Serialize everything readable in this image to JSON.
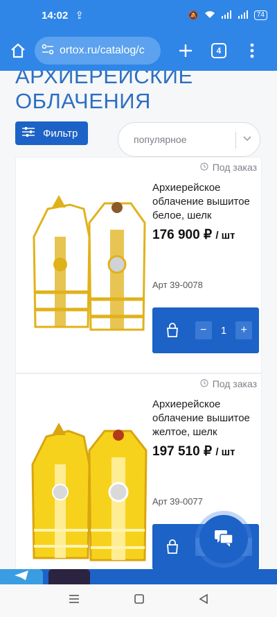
{
  "status_bar": {
    "time": "14:02",
    "battery": "74"
  },
  "browser": {
    "url": "ortox.ru/catalog/c",
    "tab_count": "4"
  },
  "page": {
    "heading_line1": "АРХИЕРЕЙСКИЕ",
    "heading_line2": "ОБЛАЧЕНИЯ",
    "filter_label": "Фильтр",
    "sort_value": "популярное"
  },
  "products": [
    {
      "availability": "Под заказ",
      "name": "Архиерейское облачение вышитое белое, шелк",
      "price": "176 900 ₽",
      "unit": "/ шт",
      "sku": "Арт 39-0078",
      "quantity": "1",
      "robe_color": "#ffffff",
      "trim_color": "#e0b21a"
    },
    {
      "availability": "Под заказ",
      "name": "Архиерейское облачение вышитое желтое, шелк",
      "price": "197 510 ₽",
      "unit": "/ шт",
      "sku": "Арт 39-0077",
      "quantity": "1",
      "robe_color": "#f7d21c",
      "trim_color": "#d9a510"
    }
  ],
  "accent_color": "#1d62c6",
  "nav": {
    "menu_icon": "menu-icon",
    "home_icon": "square-icon",
    "back_icon": "back-icon"
  }
}
